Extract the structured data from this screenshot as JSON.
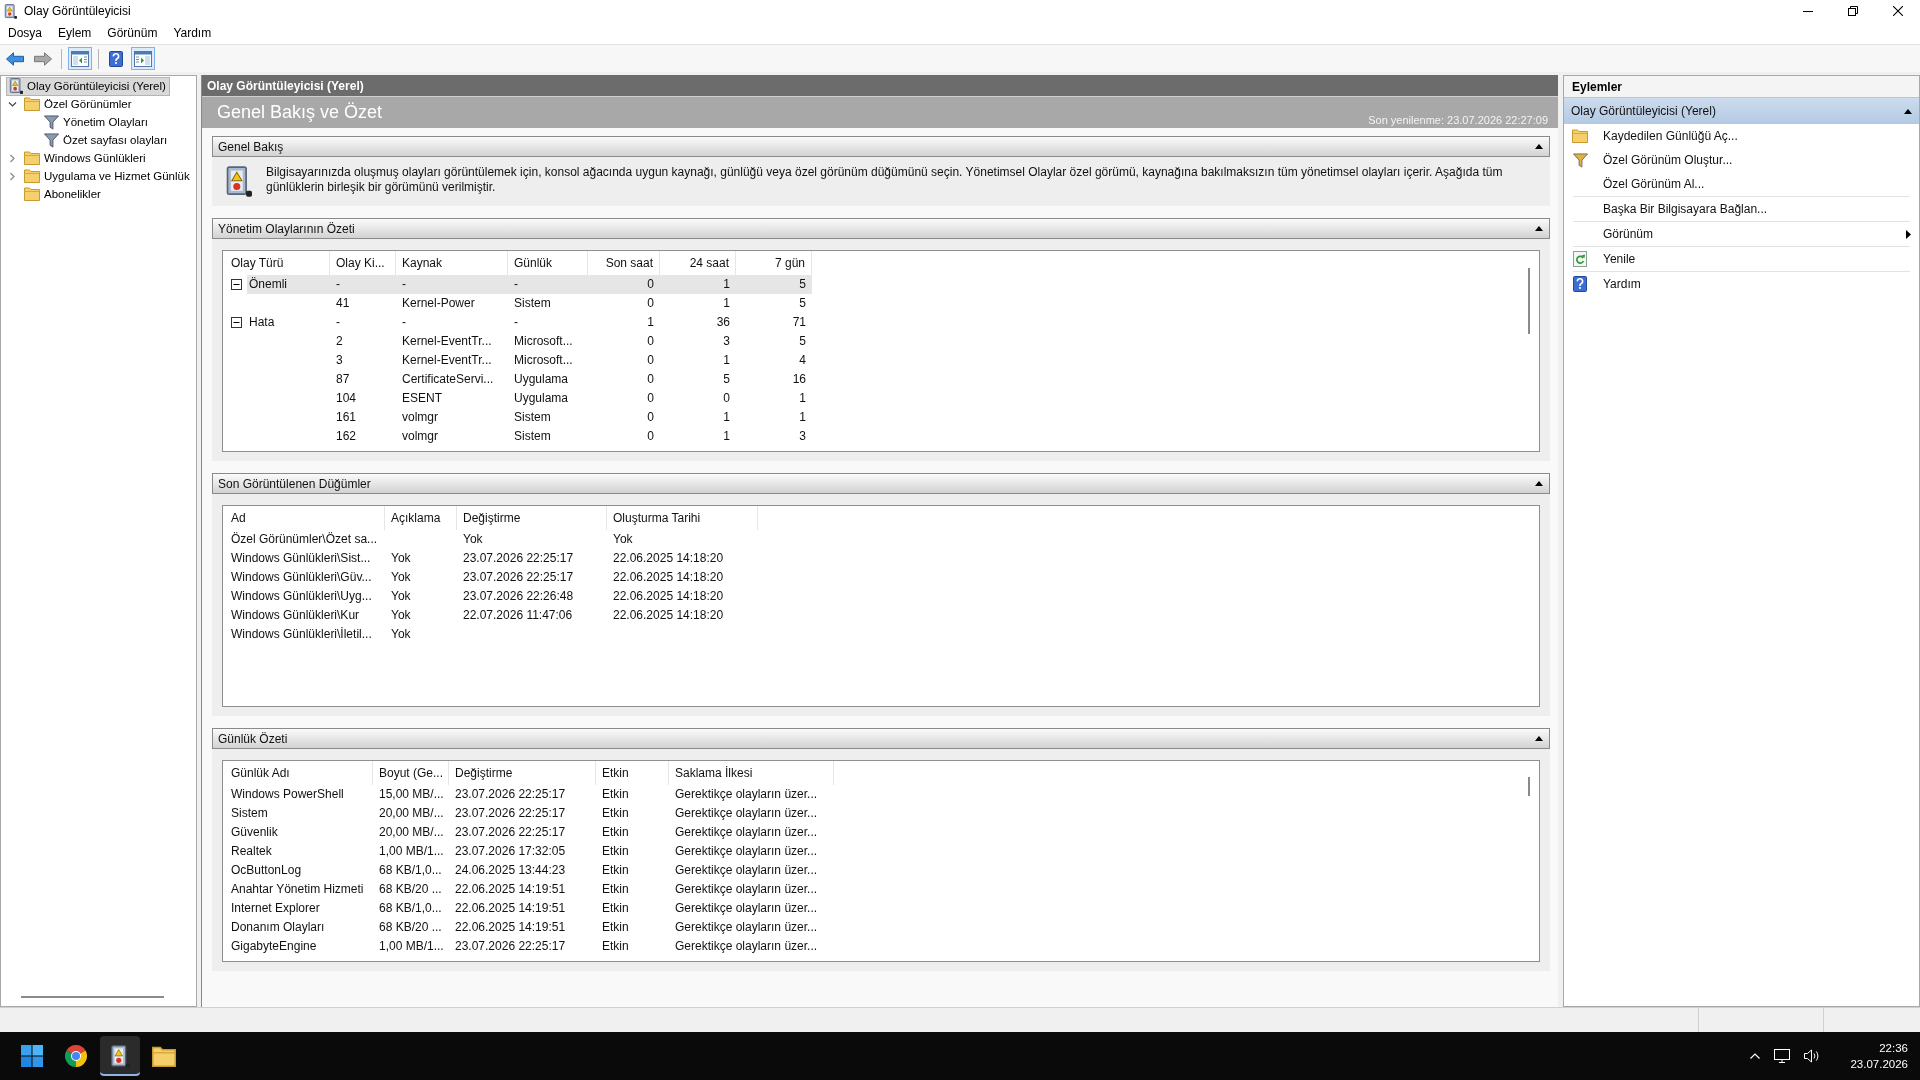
{
  "window": {
    "title": "Olay Görüntüleyicisi"
  },
  "menu": [
    "Dosya",
    "Eylem",
    "Görünüm",
    "Yardım"
  ],
  "toolbar": {
    "navigation": [
      {
        "disabled": false
      },
      {
        "disabled": true
      }
    ],
    "toggles": [
      {
        "pressed": true
      },
      {
        "pressed": false
      },
      {
        "pressed": true
      }
    ]
  },
  "tree": [
    {
      "label": "Olay Görüntüleyicisi (Yerel)",
      "selected": true,
      "children": [
        {
          "label": "Özel Görünümler",
          "selected": false,
          "expanded": true,
          "children": [
            {
              "label": "Yönetim Olayları",
              "selected": false
            },
            {
              "label": "Özet sayfası olayları",
              "selected": false
            }
          ]
        },
        {
          "label": "Windows Günlükleri",
          "selected": false,
          "expanded": false
        },
        {
          "label": "Uygulama ve Hizmet Günlük",
          "selected": false,
          "expanded": false
        },
        {
          "label": "Abonelikler",
          "selected": false
        }
      ]
    }
  ],
  "center": {
    "title": "Olay Görüntüleyicisi (Yerel)",
    "heading": "Genel Bakış ve Özet",
    "refreshed": "Son yenilenme: 23.07.2026 22:27:09",
    "overview": {
      "title": "Genel Bakış",
      "expanded": true,
      "text": "Bilgisayarınızda oluşmuş olayları görüntülemek için, konsol ağacında uygun kaynağı, günlüğü veya özel görünüm düğümünü seçin. Yönetimsel Olaylar özel görümü, kaynağına bakılmaksızın tüm yönetimsel olayları içerir. Aşağıda tüm günlüklerin birleşik bir görümünü verilmiştir."
    },
    "event_summary": {
      "title": "Yönetim Olaylarının Özeti",
      "expanded": true,
      "columns": [
        "Olay Türü",
        "Olay Ki...",
        "Kaynak",
        "Günlük",
        "Son saat",
        "24 saat",
        "7 gün"
      ],
      "groups": [
        {
          "label": "Önemli",
          "expanded": true,
          "selected": true,
          "cells": [
            "-",
            "-",
            "-",
            "0",
            "1",
            "5"
          ],
          "rows": [
            {
              "selected": false,
              "cells": [
                "41",
                "Kernel-Power",
                "Sistem",
                "0",
                "1",
                "5"
              ]
            }
          ]
        },
        {
          "label": "Hata",
          "expanded": true,
          "selected": false,
          "cells": [
            "-",
            "-",
            "-",
            "1",
            "36",
            "71"
          ],
          "rows": [
            {
              "selected": false,
              "cells": [
                "2",
                "Kernel-EventTr...",
                "Microsoft...",
                "0",
                "3",
                "5"
              ]
            },
            {
              "selected": false,
              "cells": [
                "3",
                "Kernel-EventTr...",
                "Microsoft...",
                "0",
                "1",
                "4"
              ]
            },
            {
              "selected": false,
              "cells": [
                "87",
                "CertificateServi...",
                "Uygulama",
                "0",
                "5",
                "16"
              ]
            },
            {
              "selected": false,
              "cells": [
                "104",
                "ESENT",
                "Uygulama",
                "0",
                "0",
                "1"
              ]
            },
            {
              "selected": false,
              "cells": [
                "161",
                "volmgr",
                "Sistem",
                "0",
                "1",
                "1"
              ]
            },
            {
              "selected": false,
              "cells": [
                "162",
                "volmgr",
                "Sistem",
                "0",
                "1",
                "3"
              ]
            }
          ]
        }
      ]
    },
    "recent_nodes": {
      "title": "Son Görüntülenen Düğümler",
      "expanded": true,
      "columns": [
        "Ad",
        "Açıklama",
        "Değiştirme",
        "Oluşturma Tarihi"
      ],
      "rows": [
        {
          "name": "Özel Görünümler\\Özet sa...",
          "modified": "Yok",
          "created": "Yok"
        },
        {
          "name": "Windows Günlükleri\\Sist...",
          "description": "Yok",
          "modified": "23.07.2026 22:25:17",
          "created": "22.06.2025 14:18:20"
        },
        {
          "name": "Windows Günlükleri\\Güv...",
          "description": "Yok",
          "modified": "23.07.2026 22:25:17",
          "created": "22.06.2025 14:18:20"
        },
        {
          "name": "Windows Günlükleri\\Uyg...",
          "description": "Yok",
          "modified": "23.07.2026 22:26:48",
          "created": "22.06.2025 14:18:20"
        },
        {
          "name": "Windows Günlükleri\\Kur",
          "description": "Yok",
          "modified": "22.07.2026 11:47:06",
          "created": "22.06.2025 14:18:20"
        },
        {
          "name": "Windows Günlükleri\\İletil...",
          "description": "Yok"
        }
      ]
    },
    "log_summary": {
      "title": "Günlük Özeti",
      "expanded": true,
      "columns": [
        "Günlük Adı",
        "Boyut (Ge...",
        "Değiştirme",
        "Etkin",
        "Saklama İlkesi"
      ],
      "rows": [
        [
          "Windows PowerShell",
          "15,00 MB/...",
          "23.07.2026 22:25:17",
          "Etkin",
          "Gerektikçe olayların üzer..."
        ],
        [
          "Sistem",
          "20,00 MB/...",
          "23.07.2026 22:25:17",
          "Etkin",
          "Gerektikçe olayların üzer..."
        ],
        [
          "Güvenlik",
          "20,00 MB/...",
          "23.07.2026 22:25:17",
          "Etkin",
          "Gerektikçe olayların üzer..."
        ],
        [
          "Realtek",
          "1,00 MB/1...",
          "23.07.2026 17:32:05",
          "Etkin",
          "Gerektikçe olayların üzer..."
        ],
        [
          "OcButtonLog",
          "68 KB/1,0...",
          "24.06.2025 13:44:23",
          "Etkin",
          "Gerektikçe olayların üzer..."
        ],
        [
          "Anahtar Yönetim Hizmeti",
          "68 KB/20 ...",
          "22.06.2025 14:19:51",
          "Etkin",
          "Gerektikçe olayların üzer..."
        ],
        [
          "Internet Explorer",
          "68 KB/1,0...",
          "22.06.2025 14:19:51",
          "Etkin",
          "Gerektikçe olayların üzer..."
        ],
        [
          "Donanım Olayları",
          "68 KB/20 ...",
          "22.06.2025 14:19:51",
          "Etkin",
          "Gerektikçe olayların üzer..."
        ],
        [
          "GigabyteEngine",
          "1,00 MB/1...",
          "23.07.2026 22:25:17",
          "Etkin",
          "Gerektikçe olayların üzer..."
        ]
      ]
    }
  },
  "actions": {
    "title": "Eylemler",
    "group": {
      "title": "Olay Görüntüleyicisi (Yerel)",
      "expanded": true,
      "sections": [
        {
          "items": [
            {
              "label": "Kaydedilen Günlüğü Aç...",
              "kind": "command"
            },
            {
              "label": "Özel Görünüm Oluştur...",
              "kind": "command"
            },
            {
              "label": "Özel Görünüm Al...",
              "kind": "command"
            }
          ]
        },
        {
          "items": [
            {
              "label": "Başka Bir Bilgisayara Bağlan...",
              "kind": "command"
            }
          ]
        },
        {
          "items": [
            {
              "label": "Görünüm",
              "kind": "submenu"
            }
          ]
        },
        {
          "items": [
            {
              "label": "Yenile",
              "kind": "command"
            }
          ]
        },
        {
          "items": [
            {
              "label": "Yardım",
              "kind": "command"
            }
          ]
        }
      ]
    }
  },
  "taskbar": {
    "apps": [
      {
        "active": false
      },
      {
        "active": true
      },
      {
        "active": false
      }
    ],
    "clock": {
      "time": "22:36",
      "date": "23.07.2026"
    }
  }
}
